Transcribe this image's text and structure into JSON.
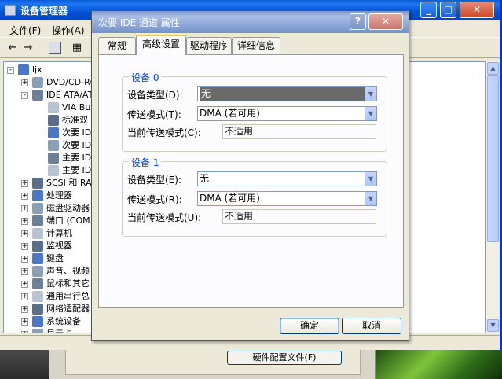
{
  "device_manager": {
    "title": "设备管理器",
    "menu": [
      "文件(F)",
      "操作(A)"
    ],
    "tree": [
      {
        "label": "ljx",
        "level": 0,
        "expander": "-"
      },
      {
        "label": "DVD/CD-RO",
        "level": 1,
        "expander": "+"
      },
      {
        "label": "IDE ATA/AT",
        "level": 1,
        "expander": "-"
      },
      {
        "label": "VIA Bus",
        "level": 2,
        "expander": ""
      },
      {
        "label": "标准双",
        "level": 2,
        "expander": ""
      },
      {
        "label": "次要 ID",
        "level": 2,
        "expander": ""
      },
      {
        "label": "次要 ID",
        "level": 2,
        "expander": ""
      },
      {
        "label": "主要 ID",
        "level": 2,
        "expander": ""
      },
      {
        "label": "主要 ID",
        "level": 2,
        "expander": ""
      },
      {
        "label": "SCSI 和 RA",
        "level": 1,
        "expander": "+"
      },
      {
        "label": "处理器",
        "level": 1,
        "expander": "+"
      },
      {
        "label": "磁盘驱动器",
        "level": 1,
        "expander": "+"
      },
      {
        "label": "端口 (COM",
        "level": 1,
        "expander": "+"
      },
      {
        "label": "计算机",
        "level": 1,
        "expander": "+"
      },
      {
        "label": "监视器",
        "level": 1,
        "expander": "+"
      },
      {
        "label": "键盘",
        "level": 1,
        "expander": "+"
      },
      {
        "label": "声音、视频",
        "level": 1,
        "expander": "+"
      },
      {
        "label": "鼠标和其它",
        "level": 1,
        "expander": "+"
      },
      {
        "label": "通用串行总",
        "level": 1,
        "expander": "+"
      },
      {
        "label": "网络适配器",
        "level": 1,
        "expander": "+"
      },
      {
        "label": "系统设备",
        "level": 1,
        "expander": "+"
      },
      {
        "label": "显示卡",
        "level": 1,
        "expander": "+"
      }
    ]
  },
  "dialog": {
    "title": "次要 IDE 通道 属性",
    "help": "?",
    "close": "✕",
    "tabs": [
      "常规",
      "高级设置",
      "驱动程序",
      "详细信息"
    ],
    "active_tab": "高级设置",
    "device0": {
      "group": "设备 0",
      "type_label": "设备类型(D):",
      "type_value": "无",
      "mode_label": "传送模式(T):",
      "mode_value": "DMA (若可用)",
      "current_label": "当前传送模式(C):",
      "current_value": "不适用"
    },
    "device1": {
      "group": "设备 1",
      "type_label": "设备类型(E):",
      "type_value": "无",
      "mode_label": "传送模式(R):",
      "mode_value": "DMA (若可用)",
      "current_label": "当前传送模式(U):",
      "current_value": "不适用"
    },
    "ok": "确定",
    "cancel": "取消"
  },
  "background_button": "硬件配置文件(F)",
  "colors": {
    "accent": "#0046d5",
    "titlebar_inactive": "#7b96c4",
    "titlebar_active": "#0053d6"
  }
}
